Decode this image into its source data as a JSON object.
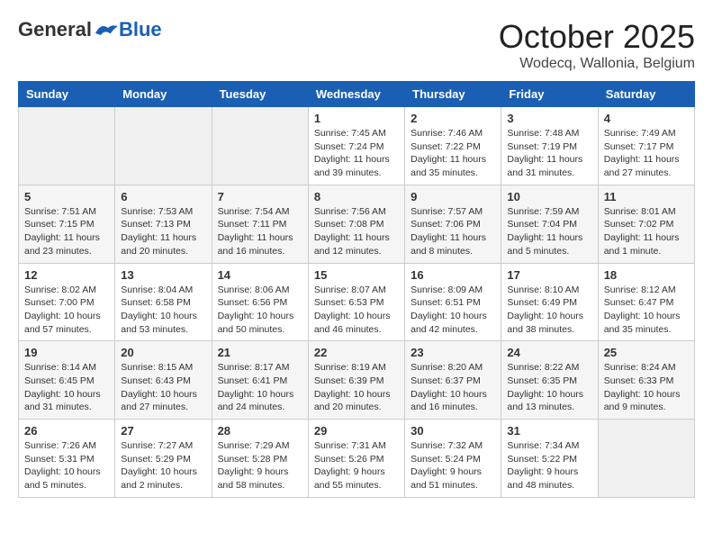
{
  "header": {
    "logo_general": "General",
    "logo_blue": "Blue",
    "month": "October 2025",
    "location": "Wodecq, Wallonia, Belgium"
  },
  "days_of_week": [
    "Sunday",
    "Monday",
    "Tuesday",
    "Wednesday",
    "Thursday",
    "Friday",
    "Saturday"
  ],
  "weeks": [
    [
      {
        "day": "",
        "info": ""
      },
      {
        "day": "",
        "info": ""
      },
      {
        "day": "",
        "info": ""
      },
      {
        "day": "1",
        "info": "Sunrise: 7:45 AM\nSunset: 7:24 PM\nDaylight: 11 hours and 39 minutes."
      },
      {
        "day": "2",
        "info": "Sunrise: 7:46 AM\nSunset: 7:22 PM\nDaylight: 11 hours and 35 minutes."
      },
      {
        "day": "3",
        "info": "Sunrise: 7:48 AM\nSunset: 7:19 PM\nDaylight: 11 hours and 31 minutes."
      },
      {
        "day": "4",
        "info": "Sunrise: 7:49 AM\nSunset: 7:17 PM\nDaylight: 11 hours and 27 minutes."
      }
    ],
    [
      {
        "day": "5",
        "info": "Sunrise: 7:51 AM\nSunset: 7:15 PM\nDaylight: 11 hours and 23 minutes."
      },
      {
        "day": "6",
        "info": "Sunrise: 7:53 AM\nSunset: 7:13 PM\nDaylight: 11 hours and 20 minutes."
      },
      {
        "day": "7",
        "info": "Sunrise: 7:54 AM\nSunset: 7:11 PM\nDaylight: 11 hours and 16 minutes."
      },
      {
        "day": "8",
        "info": "Sunrise: 7:56 AM\nSunset: 7:08 PM\nDaylight: 11 hours and 12 minutes."
      },
      {
        "day": "9",
        "info": "Sunrise: 7:57 AM\nSunset: 7:06 PM\nDaylight: 11 hours and 8 minutes."
      },
      {
        "day": "10",
        "info": "Sunrise: 7:59 AM\nSunset: 7:04 PM\nDaylight: 11 hours and 5 minutes."
      },
      {
        "day": "11",
        "info": "Sunrise: 8:01 AM\nSunset: 7:02 PM\nDaylight: 11 hours and 1 minute."
      }
    ],
    [
      {
        "day": "12",
        "info": "Sunrise: 8:02 AM\nSunset: 7:00 PM\nDaylight: 10 hours and 57 minutes."
      },
      {
        "day": "13",
        "info": "Sunrise: 8:04 AM\nSunset: 6:58 PM\nDaylight: 10 hours and 53 minutes."
      },
      {
        "day": "14",
        "info": "Sunrise: 8:06 AM\nSunset: 6:56 PM\nDaylight: 10 hours and 50 minutes."
      },
      {
        "day": "15",
        "info": "Sunrise: 8:07 AM\nSunset: 6:53 PM\nDaylight: 10 hours and 46 minutes."
      },
      {
        "day": "16",
        "info": "Sunrise: 8:09 AM\nSunset: 6:51 PM\nDaylight: 10 hours and 42 minutes."
      },
      {
        "day": "17",
        "info": "Sunrise: 8:10 AM\nSunset: 6:49 PM\nDaylight: 10 hours and 38 minutes."
      },
      {
        "day": "18",
        "info": "Sunrise: 8:12 AM\nSunset: 6:47 PM\nDaylight: 10 hours and 35 minutes."
      }
    ],
    [
      {
        "day": "19",
        "info": "Sunrise: 8:14 AM\nSunset: 6:45 PM\nDaylight: 10 hours and 31 minutes."
      },
      {
        "day": "20",
        "info": "Sunrise: 8:15 AM\nSunset: 6:43 PM\nDaylight: 10 hours and 27 minutes."
      },
      {
        "day": "21",
        "info": "Sunrise: 8:17 AM\nSunset: 6:41 PM\nDaylight: 10 hours and 24 minutes."
      },
      {
        "day": "22",
        "info": "Sunrise: 8:19 AM\nSunset: 6:39 PM\nDaylight: 10 hours and 20 minutes."
      },
      {
        "day": "23",
        "info": "Sunrise: 8:20 AM\nSunset: 6:37 PM\nDaylight: 10 hours and 16 minutes."
      },
      {
        "day": "24",
        "info": "Sunrise: 8:22 AM\nSunset: 6:35 PM\nDaylight: 10 hours and 13 minutes."
      },
      {
        "day": "25",
        "info": "Sunrise: 8:24 AM\nSunset: 6:33 PM\nDaylight: 10 hours and 9 minutes."
      }
    ],
    [
      {
        "day": "26",
        "info": "Sunrise: 7:26 AM\nSunset: 5:31 PM\nDaylight: 10 hours and 5 minutes."
      },
      {
        "day": "27",
        "info": "Sunrise: 7:27 AM\nSunset: 5:29 PM\nDaylight: 10 hours and 2 minutes."
      },
      {
        "day": "28",
        "info": "Sunrise: 7:29 AM\nSunset: 5:28 PM\nDaylight: 9 hours and 58 minutes."
      },
      {
        "day": "29",
        "info": "Sunrise: 7:31 AM\nSunset: 5:26 PM\nDaylight: 9 hours and 55 minutes."
      },
      {
        "day": "30",
        "info": "Sunrise: 7:32 AM\nSunset: 5:24 PM\nDaylight: 9 hours and 51 minutes."
      },
      {
        "day": "31",
        "info": "Sunrise: 7:34 AM\nSunset: 5:22 PM\nDaylight: 9 hours and 48 minutes."
      },
      {
        "day": "",
        "info": ""
      }
    ]
  ]
}
